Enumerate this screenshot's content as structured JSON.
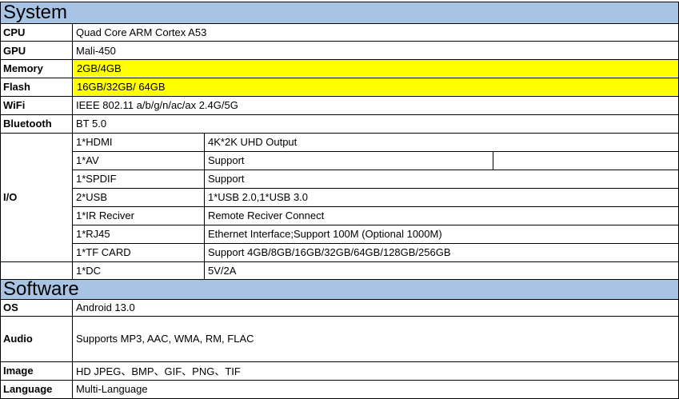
{
  "system": {
    "title": "System",
    "cpu": {
      "label": "CPU",
      "value": "Quad Core ARM Cortex A53"
    },
    "gpu": {
      "label": "GPU",
      "value": "Mali-450"
    },
    "memory": {
      "label": "Memory",
      "value": "2GB/4GB"
    },
    "flash": {
      "label": "Flash",
      "value": "16GB/32GB/ 64GB"
    },
    "wifi": {
      "label": "WiFi",
      "value": "IEEE 802.11 a/b/g/n/ac/ax   2.4G/5G"
    },
    "bluetooth": {
      "label": "Bluetooth",
      "value": "BT 5.0"
    },
    "io": {
      "label": "I/O",
      "rows": [
        {
          "port": "1*HDMI",
          "spec": "4K*2K UHD Output"
        },
        {
          "port": "1*AV",
          "spec": "Support"
        },
        {
          "port": "1*SPDIF",
          "spec": "Support"
        },
        {
          "port": "2*USB",
          "spec": "1*USB 2.0,1*USB 3.0"
        },
        {
          "port": "1*IR Reciver",
          "spec": "Remote Reciver Connect"
        },
        {
          "port": "1*RJ45",
          "spec": "Ethernet Interface;Support 100M  (Optional 1000M)"
        },
        {
          "port": "1*TF CARD",
          "spec": "Support 4GB/8GB/16GB/32GB/64GB/128GB/256GB"
        },
        {
          "port": "1*DC",
          "spec": "5V/2A"
        }
      ]
    }
  },
  "software": {
    "title": "Software",
    "os": {
      "label": "OS",
      "value": "Android 13.0"
    },
    "audio": {
      "label": "Audio",
      "value": "Supports MP3, AAC, WMA, RM, FLAC"
    },
    "image": {
      "label": "Image",
      "value": "HD JPEG、BMP、GIF、PNG、TIF"
    },
    "language": {
      "label": "Language",
      "value": "Multi-Language"
    }
  },
  "colors": {
    "section_header": "#a7c4e5",
    "highlight": "#ffff00"
  }
}
